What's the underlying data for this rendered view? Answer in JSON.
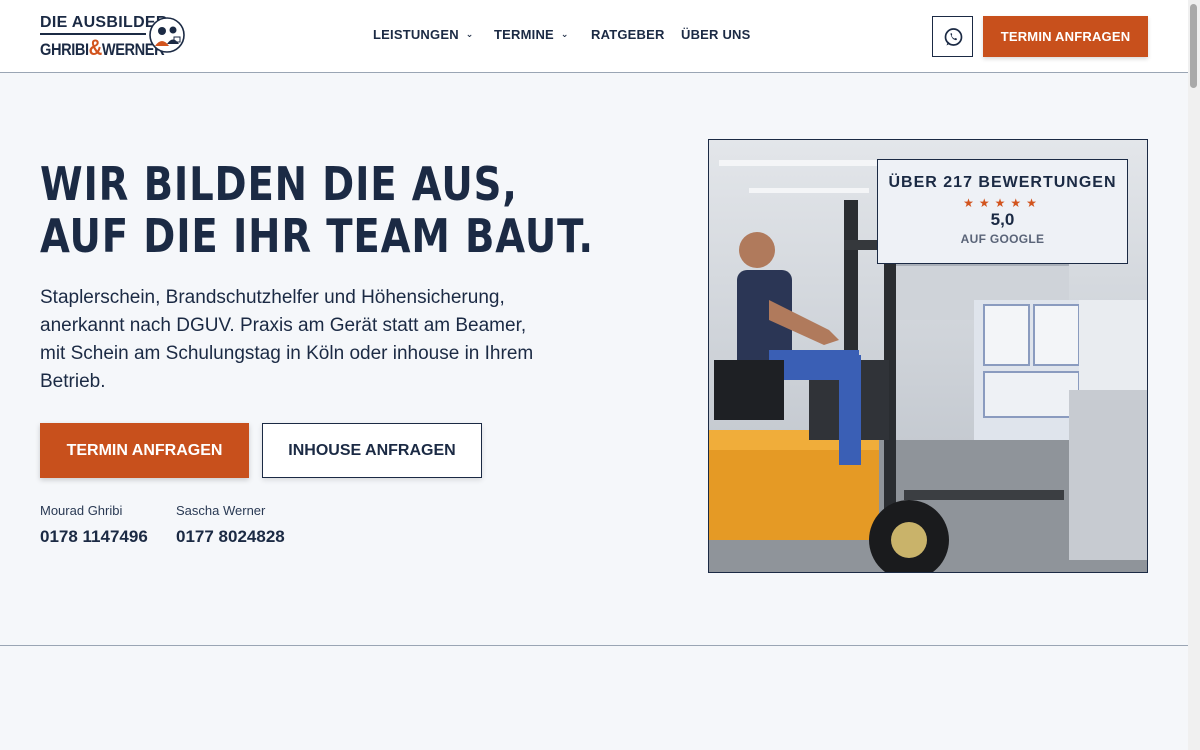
{
  "brand": {
    "line1": "DIE AUSBILDER",
    "line2_a": "GHRIBI",
    "line2_amp": "&",
    "line2_b": "WERNER",
    "primary_color": "#1b2a44",
    "accent_color": "#c8501c"
  },
  "nav": {
    "items": [
      {
        "label": "LEISTUNGEN",
        "has_dropdown": true
      },
      {
        "label": "TERMINE",
        "has_dropdown": true
      },
      {
        "label": "RATGEBER",
        "has_dropdown": false
      },
      {
        "label": "ÜBER UNS",
        "has_dropdown": false
      }
    ],
    "whatsapp_icon": "whatsapp-icon",
    "cta_label": "TERMIN ANFRAGEN"
  },
  "hero": {
    "title_line1": "WIR BILDEN DIE AUS,",
    "title_line2": "AUF DIE IHR TEAM BAUT.",
    "text": "Staplerschein, Brandschutzhelfer und Höhensicherung, anerkannt nach DGUV. Praxis am Gerät statt am Beamer, mit Schein am Schulungstag in Köln oder inhouse in Ihrem Betrieb.",
    "primary_button": "TERMIN ANFRAGEN",
    "secondary_button": "INHOUSE ANFRAGEN",
    "contacts": [
      {
        "name": "Mourad Ghribi",
        "phone": "0178 1147496"
      },
      {
        "name": "Sascha Werner",
        "phone": "0177 8024828"
      }
    ]
  },
  "reviews": {
    "title": "ÜBER 217 BEWERTUNGEN",
    "stars": "★★★★★",
    "rating": 5.0,
    "score": "5,0",
    "source": "AUF GOOGLE"
  }
}
